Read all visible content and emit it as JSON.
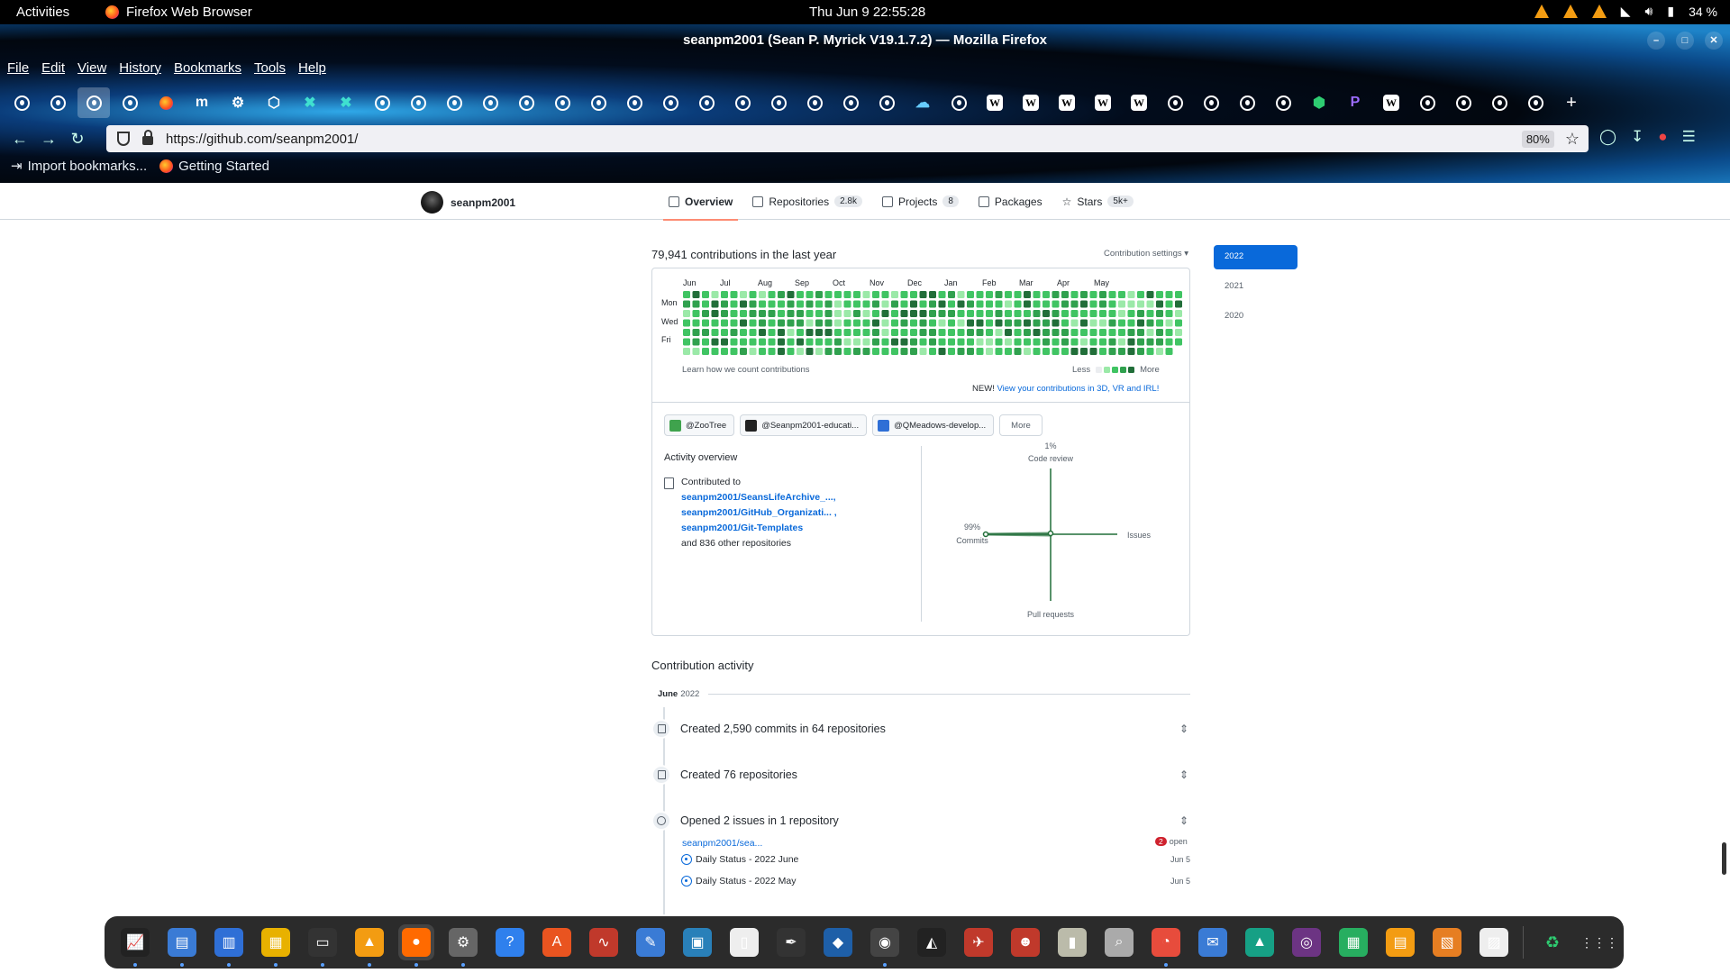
{
  "topbar": {
    "activities": "Activities",
    "app_name": "Firefox Web Browser",
    "clock": "Thu Jun 9  22:55:28",
    "battery": "34 %"
  },
  "browser": {
    "window_title": "seanpm2001 (Sean P. Myrick V19.1.7.2) — Mozilla Firefox",
    "menu": [
      "File",
      "Edit",
      "View",
      "History",
      "Bookmarks",
      "Tools",
      "Help"
    ],
    "url": "https://github.com/seanpm2001/",
    "zoom": "80%",
    "bookmarks": [
      "Import bookmarks...",
      "Getting Started"
    ],
    "tab_icons": [
      "github",
      "github",
      "github",
      "github",
      "firefox",
      "m",
      "gear",
      "puzzle",
      "x",
      "x",
      "github",
      "github",
      "github",
      "github",
      "github",
      "github",
      "github",
      "github",
      "github",
      "github",
      "github",
      "github",
      "github",
      "github",
      "github",
      "cloud",
      "github",
      "w",
      "w",
      "w",
      "w",
      "w",
      "github",
      "github",
      "github",
      "github",
      "shield",
      "p",
      "w",
      "github",
      "github",
      "github",
      "github"
    ]
  },
  "github": {
    "username": "seanpm2001",
    "tabs": [
      {
        "label": "Overview",
        "count": ""
      },
      {
        "label": "Repositories",
        "count": "2.8k"
      },
      {
        "label": "Projects",
        "count": "8"
      },
      {
        "label": "Packages",
        "count": ""
      },
      {
        "label": "Stars",
        "count": "5k+"
      }
    ],
    "contributions_title": "79,941 contributions in the last year",
    "contribution_settings": "Contribution settings ▾",
    "months": [
      "Jun",
      "Jul",
      "Aug",
      "Sep",
      "Oct",
      "Nov",
      "Dec",
      "Jan",
      "Feb",
      "Mar",
      "Apr",
      "May"
    ],
    "days": [
      "Mon",
      "Wed",
      "Fri"
    ],
    "learn_link": "Learn how we count contributions",
    "legend_less": "Less",
    "legend_more": "More",
    "new_label": "NEW!",
    "new_link": "View your contributions in 3D, VR and IRL!",
    "orgs": [
      "@ZooTree",
      "@Seanpm2001-educati...",
      "@QMeadows-develop...",
      "More"
    ],
    "activity_overview": "Activity overview",
    "contributed_to": "Contributed to",
    "repos": [
      "seanpm2001/SeansLifeArchive_...,",
      "seanpm2001/GitHub_Organizati... ,",
      "seanpm2001/Git-Templates"
    ],
    "other_repos": "and 836 other repositories",
    "radar": {
      "code_review_pct": "1%",
      "code_review": "Code review",
      "commits_pct": "99%",
      "commits": "Commits",
      "issues": "Issues",
      "pull_requests": "Pull requests"
    },
    "years": [
      "2022",
      "2021",
      "2020"
    ],
    "contribution_activity": "Contribution activity",
    "month_heading": "June",
    "month_year": "2022",
    "activities": [
      "Created 2,590 commits in 64 repositories",
      "Created 76 repositories",
      "Opened 2 issues in 1 repository"
    ],
    "issue_repo": "seanpm2001/sea...",
    "open_count": "2",
    "open_label": "open",
    "issues": [
      {
        "title": "Daily Status - 2022 June",
        "date": "Jun 5"
      },
      {
        "title": "Daily Status - 2022 May",
        "date": "Jun 5"
      }
    ]
  },
  "colors": {
    "accent": "#0969da",
    "green_levels": [
      "#ebedf0",
      "#9be9a8",
      "#40c463",
      "#30a14e",
      "#216e39"
    ]
  }
}
